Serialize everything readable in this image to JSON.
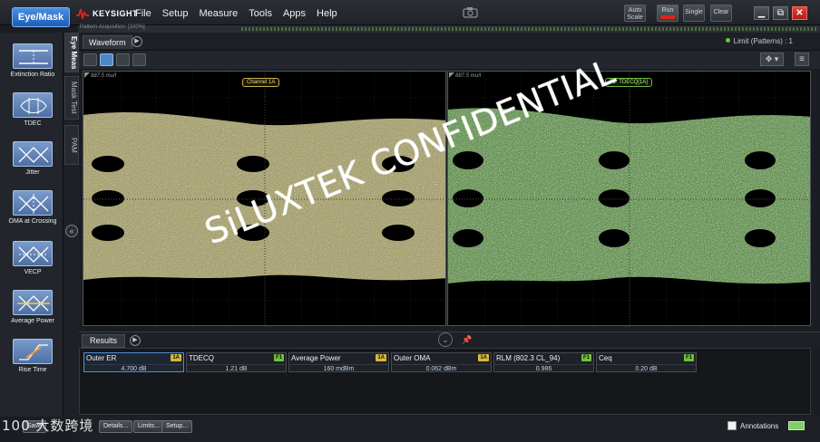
{
  "app": {
    "mode_button": "Eye/Mask",
    "brand": "KEYSIGHT",
    "menu": [
      "File",
      "Setup",
      "Measure",
      "Tools",
      "Apps",
      "Help"
    ],
    "acquisition_label": "Pattern Acquisition: [100%]",
    "toolbar": {
      "auto_scale": "Auto Scale",
      "run": "Run",
      "stop": "Stop",
      "single": "Single",
      "clear": "Clear"
    }
  },
  "sidebar": {
    "items": [
      {
        "label": "Extinction Ratio",
        "icon": "extinction-ratio-icon",
        "sub": "1/0"
      },
      {
        "label": "TDEC",
        "icon": "tdec-icon"
      },
      {
        "label": "Jitter",
        "icon": "jitter-icon"
      },
      {
        "label": "OMA at Crossing",
        "icon": "oma-crossing-icon"
      },
      {
        "label": "VECP",
        "icon": "vecp-icon"
      },
      {
        "label": "Average Power",
        "icon": "average-power-icon"
      },
      {
        "label": "Rise Time",
        "icon": "rise-time-icon"
      }
    ]
  },
  "vtabs": [
    "Eye Meas",
    "Mask Test",
    "PAM"
  ],
  "waveform": {
    "tab": "Waveform",
    "limit_status": "Limit (Patterns) : 1",
    "left_pane": {
      "scale": "887.5 mu/I",
      "tag": "Channel 1A"
    },
    "right_pane": {
      "scale": "887.5 mu/I",
      "tag": "F1: TDECQ[1A]"
    }
  },
  "watermark": "SiLUXTEK CONFIDENTIAL",
  "results": {
    "tab": "Results",
    "cells": [
      {
        "name": "Outer ER",
        "badge": "1A",
        "value": "4.700 dB",
        "selected": true
      },
      {
        "name": "TDECQ",
        "badge": "F1",
        "value": "1.21 dB"
      },
      {
        "name": "Average Power",
        "badge": "1A",
        "value": "160 mdBm"
      },
      {
        "name": "Outer OMA",
        "badge": "1A",
        "value": "0.062 dBm"
      },
      {
        "name": "RLM (802.3 CL_94)",
        "badge": "F1",
        "value": "0.986"
      },
      {
        "name": "Ceq",
        "badge": "F1",
        "value": "0.20 dB"
      }
    ]
  },
  "footer": {
    "buttons": [
      "Save",
      "Details...",
      "Limits...",
      "Setup..."
    ],
    "annotations_label": "Annotations"
  },
  "corner_brand": "100 大数跨境",
  "colors": {
    "eye_left": "#e6dc7a",
    "eye_right": "#7fe05a",
    "accent": "#3d7ed4"
  }
}
